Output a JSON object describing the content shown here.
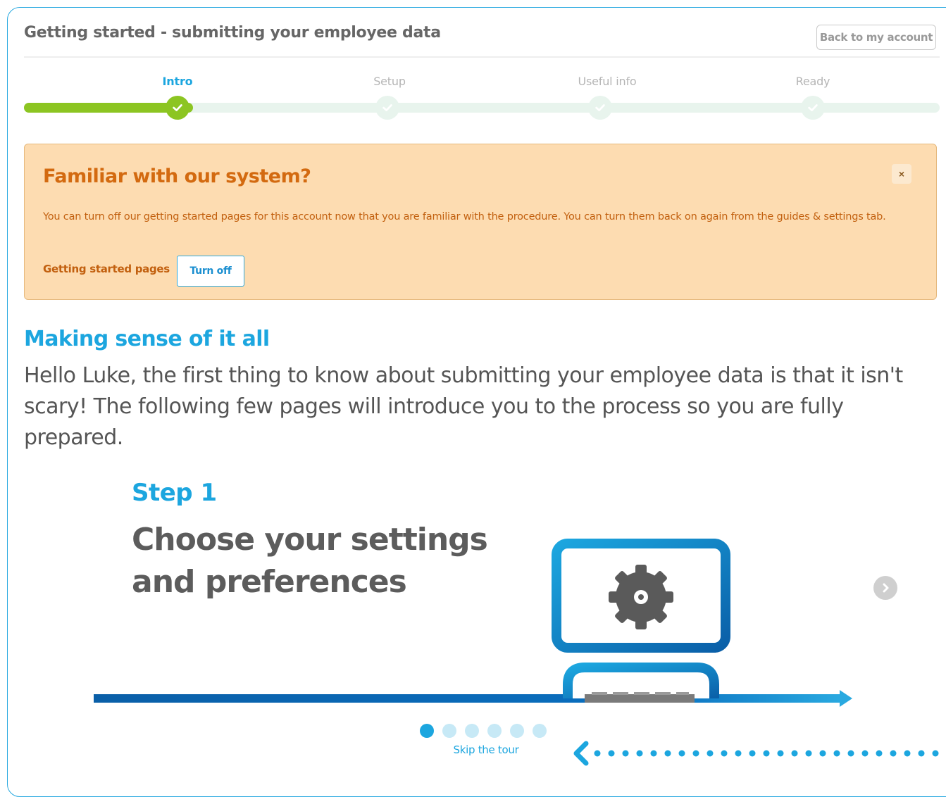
{
  "header": {
    "title": "Getting started - submitting your employee data",
    "back_button_label": "Back to my account"
  },
  "progress": {
    "steps": [
      {
        "label": "Intro",
        "state": "completed"
      },
      {
        "label": "Setup",
        "state": "pending"
      },
      {
        "label": "Useful info",
        "state": "pending"
      },
      {
        "label": "Ready",
        "state": "pending"
      }
    ],
    "current_step": 1,
    "colors": {
      "active": "#8cc522",
      "inactive": "#e8f4ed",
      "active_label": "#1ca6df"
    }
  },
  "notice": {
    "title": "Familiar with our system?",
    "close_label": "×",
    "body": "You can turn off our getting started pages for this account now that you are familiar with the procedure. You can turn them back on again from the guides & settings tab.",
    "setting_label": "Getting started pages",
    "button_label": "Turn off",
    "colors": {
      "background": "#fddcb1",
      "title": "#d36a10"
    }
  },
  "main": {
    "heading": "Making sense of it all",
    "intro": "Hello Luke, the first thing to know about submitting your employee data is that it isn't scary! The following few pages will introduce you to the process so you are fully prepared."
  },
  "tour": {
    "step_label": "Step 1",
    "step_title": "Choose your settings and preferences",
    "illustration_icon": "gear-icon",
    "next_icon": "chevron-right-icon",
    "dots_total": 6,
    "dots_active": 1,
    "skip_label": "Skip the tour",
    "colors": {
      "accent": "#1ca6df",
      "dark_blue": "#0a5fa8"
    }
  }
}
